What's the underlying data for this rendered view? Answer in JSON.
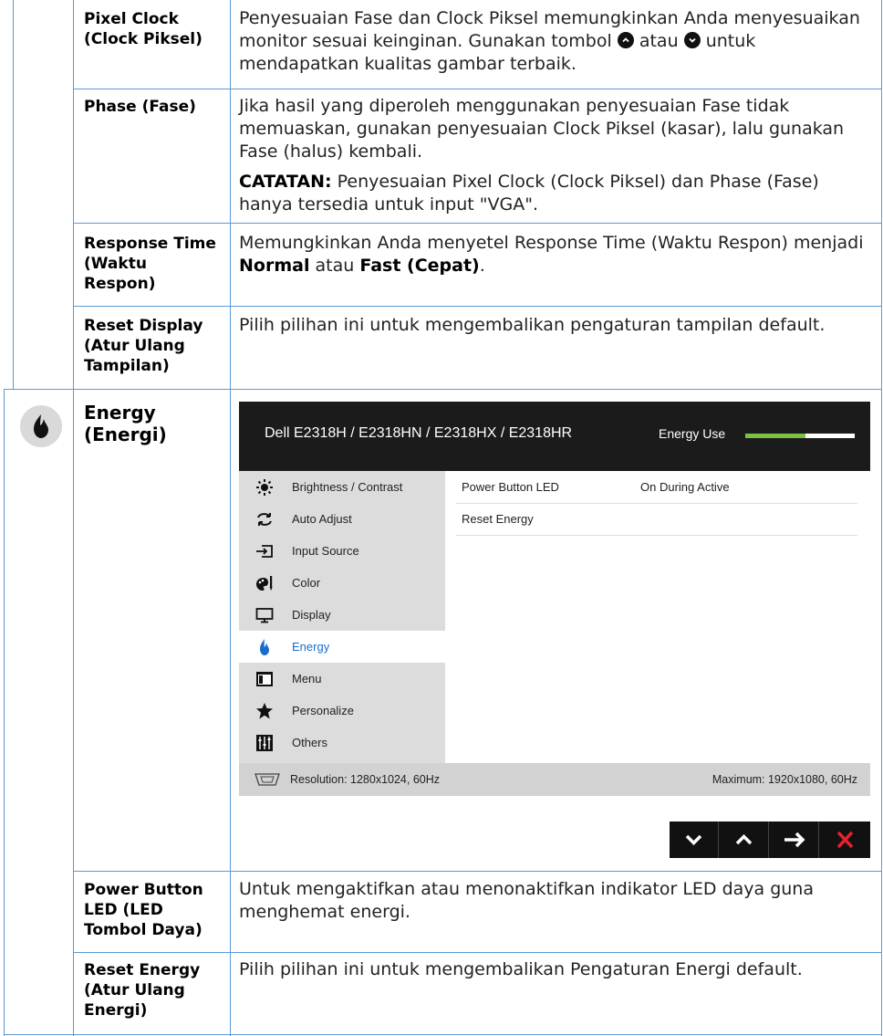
{
  "rows": {
    "pixel_clock": {
      "label": "Pixel Clock (Clock Piksel)",
      "text_1": "Penyesuaian Fase dan Clock Piksel memungkinkan Anda menyesuaikan monitor sesuai keinginan. Gunakan tombol",
      "text_2": "atau",
      "text_3": "untuk mendapatkan kualitas gambar terbaik."
    },
    "phase": {
      "label": "Phase (Fase)",
      "text": "Jika hasil yang diperoleh menggunakan penyesuaian Fase tidak memuaskan, gunakan penyesuaian Clock Piksel (kasar), lalu gunakan Fase (halus) kembali.",
      "note_label": "CATATAN:",
      "note_text": "Penyesuaian Pixel Clock (Clock Piksel) dan Phase (Fase) hanya tersedia untuk input \"VGA\"."
    },
    "response_time": {
      "label": "Response Time (Waktu Respon)",
      "text_1": "Memungkinkan Anda menyetel Response Time (Waktu Respon) menjadi",
      "opt_1": "Normal",
      "text_2": "atau",
      "opt_2": "Fast (Cepat)",
      "text_3": "."
    },
    "reset_display": {
      "label": "Reset Display (Atur Ulang Tampilan)",
      "text": "Pilih pilihan ini untuk mengembalikan pengaturan tampilan default."
    },
    "energy": {
      "label": "Energy (Energi)",
      "icon": "flame-icon"
    },
    "power_button_led": {
      "label": "Power Button LED (LED Tombol Daya)",
      "text": "Untuk mengaktifkan atau menonaktifkan indikator LED daya guna menghemat energi."
    },
    "reset_energy": {
      "label": "Reset Energy (Atur Ulang Energi)",
      "text": "Pilih pilihan ini untuk mengembalikan Pengaturan Energi default."
    }
  },
  "osd": {
    "title": "Dell E2318H / E2318HN / E2318HX / E2318HR",
    "energy_use_label": "Energy Use",
    "energy_use_fraction": 0.55,
    "menu": [
      {
        "label": "Brightness / Contrast",
        "icon": "sun-icon"
      },
      {
        "label": "Auto Adjust",
        "icon": "auto-adjust-icon"
      },
      {
        "label": "Input Source",
        "icon": "input-source-icon"
      },
      {
        "label": "Color",
        "icon": "color-icon"
      },
      {
        "label": "Display",
        "icon": "display-icon"
      },
      {
        "label": "Energy",
        "icon": "flame-icon",
        "selected": true
      },
      {
        "label": "Menu",
        "icon": "menu-window-icon"
      },
      {
        "label": "Personalize",
        "icon": "star-icon"
      },
      {
        "label": "Others",
        "icon": "sliders-icon"
      }
    ],
    "panel": [
      {
        "name": "Power Button LED",
        "value": "On During Active"
      },
      {
        "name": "Reset Energy",
        "value": ""
      }
    ],
    "footer_left": "Resolution: 1280x1024, 60Hz",
    "footer_right": "Maximum: 1920x1080, 60Hz",
    "nav_buttons": [
      "down-icon",
      "up-icon",
      "right-arrow-icon",
      "exit-icon"
    ],
    "colors": {
      "selected_text": "#1a6cc9",
      "energy_bar": "#7cc142",
      "exit": "#e0242a",
      "table_border": "#5b9bd5"
    }
  }
}
